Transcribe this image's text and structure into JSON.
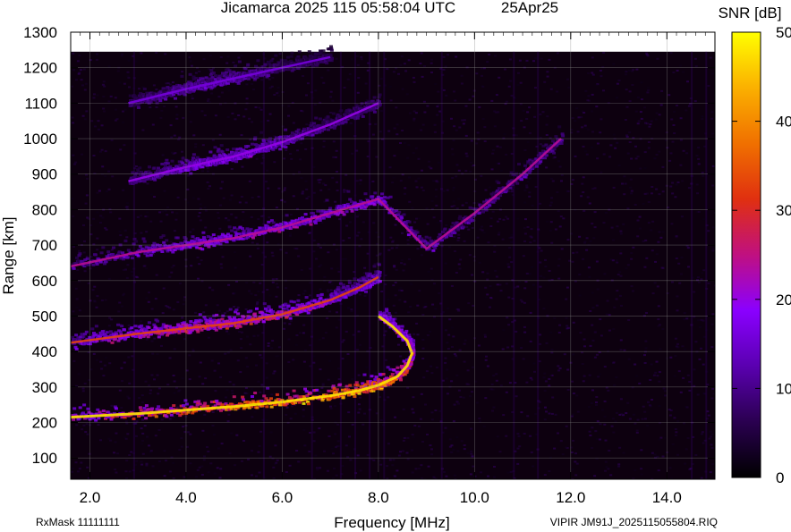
{
  "header": {
    "title": "Jicamarca 2025 115 05:58:04 UTC",
    "date": "25Apr25"
  },
  "footer": {
    "left": "RxMask 11111111",
    "right": "VIPIR  JM91J_2025115055804.RIQ"
  },
  "colorbar": {
    "label": "SNR [dB]",
    "min": 0,
    "max": 50,
    "ticks": [
      "0",
      "10",
      "20",
      "30",
      "40",
      "50"
    ],
    "colors": [
      "#000000",
      "#2a0050",
      "#5a00b0",
      "#8a00ff",
      "#c01080",
      "#e03010",
      "#f07000",
      "#fbb000",
      "#ffff00"
    ]
  },
  "chart_data": {
    "type": "heatmap",
    "title": "Jicamarca 2025 115 05:58:04 UTC",
    "xlabel": "Frequency [MHz]",
    "ylabel": "Range [km]",
    "xlim": [
      1.6,
      15.0
    ],
    "ylim": [
      40,
      1300
    ],
    "xticks": [
      "2.0",
      "4.0",
      "6.0",
      "8.0",
      "10.0",
      "12.0",
      "14.0"
    ],
    "yticks": [
      "100",
      "200",
      "300",
      "400",
      "500",
      "600",
      "700",
      "800",
      "900",
      "1000",
      "1100",
      "1200",
      "1300"
    ],
    "data_top_range": 1245,
    "grid": true,
    "echo_traces": [
      {
        "name": "",
        "points": [
          [
            1.6,
            215
          ],
          [
            3.0,
            225
          ],
          [
            4.0,
            235
          ],
          [
            5.0,
            245
          ],
          [
            6.0,
            258
          ],
          [
            7.0,
            275
          ],
          [
            7.6,
            290
          ],
          [
            8.0,
            305
          ],
          [
            8.4,
            330
          ],
          [
            8.6,
            360
          ],
          [
            8.7,
            395
          ],
          [
            8.6,
            430
          ],
          [
            8.3,
            470
          ],
          [
            8.0,
            500
          ]
        ],
        "peak_snr": 48
      },
      {
        "name": "",
        "points": [
          [
            1.6,
            425
          ],
          [
            3.0,
            450
          ],
          [
            4.0,
            465
          ],
          [
            5.0,
            480
          ],
          [
            6.0,
            505
          ],
          [
            7.0,
            545
          ],
          [
            7.6,
            580
          ],
          [
            8.0,
            610
          ]
        ],
        "peak_snr": 33
      },
      {
        "name": "",
        "points": [
          [
            1.6,
            640
          ],
          [
            3.0,
            680
          ],
          [
            4.0,
            700
          ],
          [
            5.0,
            720
          ],
          [
            6.0,
            750
          ],
          [
            7.0,
            790
          ],
          [
            8.0,
            830
          ],
          [
            9.0,
            690
          ],
          [
            10.0,
            790
          ],
          [
            11.0,
            900
          ],
          [
            11.8,
            1000
          ]
        ],
        "peak_snr": 24
      },
      {
        "name": "",
        "points": [
          [
            2.8,
            880
          ],
          [
            4.0,
            920
          ],
          [
            5.0,
            950
          ],
          [
            6.0,
            990
          ],
          [
            7.0,
            1040
          ],
          [
            8.0,
            1100
          ]
        ],
        "peak_snr": 20
      },
      {
        "name": "",
        "points": [
          [
            2.8,
            1100
          ],
          [
            4.0,
            1140
          ],
          [
            5.0,
            1170
          ],
          [
            6.0,
            1200
          ],
          [
            7.0,
            1230
          ]
        ],
        "peak_snr": 16
      }
    ],
    "noise_columns_mhz": [
      2.9,
      5.6,
      6.6,
      7.2,
      7.5,
      7.8,
      8.1,
      9.3,
      10.8,
      11.3,
      14.5,
      14.8
    ]
  }
}
